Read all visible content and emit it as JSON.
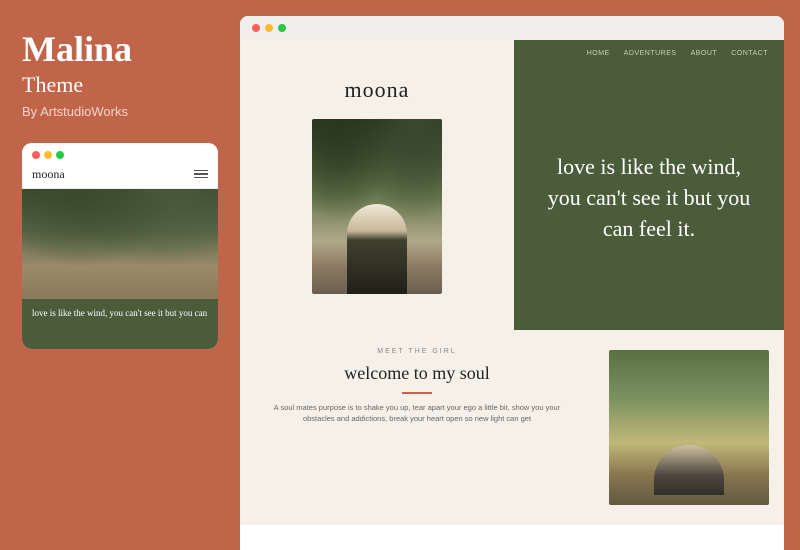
{
  "sidebar": {
    "title": "Malina",
    "subtitle": "Theme",
    "by_text": "By ArtstudioWorks",
    "mobile_preview": {
      "logo": "moona",
      "caption": "love is like the wind, you can't see it but you can"
    }
  },
  "browser": {
    "dots": [
      "red",
      "yellow",
      "green"
    ],
    "website": {
      "logo": "moona",
      "nav": {
        "items": [
          "HOME",
          "ADVENTURES",
          "ABOUT",
          "CONTACT"
        ]
      },
      "quote": "love is like the wind, you can't see it but you can feel it.",
      "bottom": {
        "meet_label": "MEET THE GIRL",
        "heading": "welcome to my soul",
        "body_text": "A soul mates purpose is to shake you up, tear apart your ego a little bit, show you your obstacles and addictions, break your heart open so new light can get"
      }
    }
  }
}
